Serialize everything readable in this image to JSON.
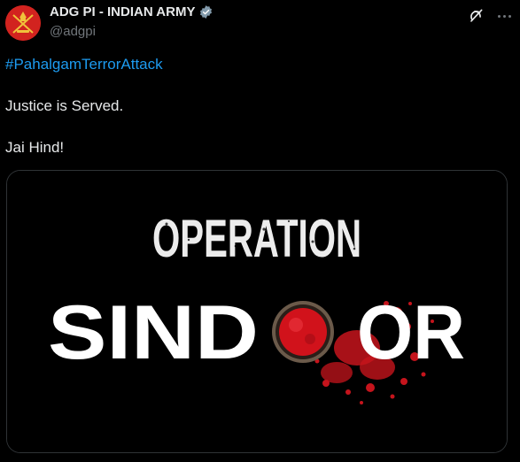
{
  "author": {
    "display_name": "ADG PI - INDIAN ARMY",
    "handle": "@adgpi",
    "avatar_icon": "army-emblem-icon",
    "verified_icon": "verified-badge-icon",
    "verified_color": "#829aab"
  },
  "tweet": {
    "hashtag": "#PahalgamTerrorAttack",
    "line1": "Justice is Served.",
    "line2": "Jai Hind!"
  },
  "media": {
    "title_top": "OPERATION",
    "title_bottom_left": "SIND",
    "title_bottom_right": "OR",
    "accent_color": "#c5141c"
  },
  "actions": {
    "grok_icon": "grok-icon",
    "more_icon": "more-options-icon"
  },
  "colors": {
    "background": "#000000",
    "text": "#e7e9ea",
    "muted": "#71767b",
    "link": "#1d9bf0"
  }
}
